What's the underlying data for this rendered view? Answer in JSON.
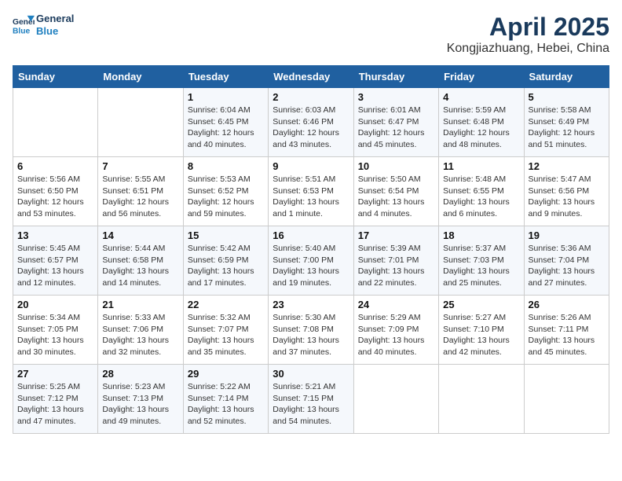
{
  "header": {
    "logo_line1": "General",
    "logo_line2": "Blue",
    "month_year": "April 2025",
    "location": "Kongjiazhuang, Hebei, China"
  },
  "weekdays": [
    "Sunday",
    "Monday",
    "Tuesday",
    "Wednesday",
    "Thursday",
    "Friday",
    "Saturday"
  ],
  "weeks": [
    [
      {
        "day": "",
        "info": ""
      },
      {
        "day": "",
        "info": ""
      },
      {
        "day": "1",
        "info": "Sunrise: 6:04 AM\nSunset: 6:45 PM\nDaylight: 12 hours and 40 minutes."
      },
      {
        "day": "2",
        "info": "Sunrise: 6:03 AM\nSunset: 6:46 PM\nDaylight: 12 hours and 43 minutes."
      },
      {
        "day": "3",
        "info": "Sunrise: 6:01 AM\nSunset: 6:47 PM\nDaylight: 12 hours and 45 minutes."
      },
      {
        "day": "4",
        "info": "Sunrise: 5:59 AM\nSunset: 6:48 PM\nDaylight: 12 hours and 48 minutes."
      },
      {
        "day": "5",
        "info": "Sunrise: 5:58 AM\nSunset: 6:49 PM\nDaylight: 12 hours and 51 minutes."
      }
    ],
    [
      {
        "day": "6",
        "info": "Sunrise: 5:56 AM\nSunset: 6:50 PM\nDaylight: 12 hours and 53 minutes."
      },
      {
        "day": "7",
        "info": "Sunrise: 5:55 AM\nSunset: 6:51 PM\nDaylight: 12 hours and 56 minutes."
      },
      {
        "day": "8",
        "info": "Sunrise: 5:53 AM\nSunset: 6:52 PM\nDaylight: 12 hours and 59 minutes."
      },
      {
        "day": "9",
        "info": "Sunrise: 5:51 AM\nSunset: 6:53 PM\nDaylight: 13 hours and 1 minute."
      },
      {
        "day": "10",
        "info": "Sunrise: 5:50 AM\nSunset: 6:54 PM\nDaylight: 13 hours and 4 minutes."
      },
      {
        "day": "11",
        "info": "Sunrise: 5:48 AM\nSunset: 6:55 PM\nDaylight: 13 hours and 6 minutes."
      },
      {
        "day": "12",
        "info": "Sunrise: 5:47 AM\nSunset: 6:56 PM\nDaylight: 13 hours and 9 minutes."
      }
    ],
    [
      {
        "day": "13",
        "info": "Sunrise: 5:45 AM\nSunset: 6:57 PM\nDaylight: 13 hours and 12 minutes."
      },
      {
        "day": "14",
        "info": "Sunrise: 5:44 AM\nSunset: 6:58 PM\nDaylight: 13 hours and 14 minutes."
      },
      {
        "day": "15",
        "info": "Sunrise: 5:42 AM\nSunset: 6:59 PM\nDaylight: 13 hours and 17 minutes."
      },
      {
        "day": "16",
        "info": "Sunrise: 5:40 AM\nSunset: 7:00 PM\nDaylight: 13 hours and 19 minutes."
      },
      {
        "day": "17",
        "info": "Sunrise: 5:39 AM\nSunset: 7:01 PM\nDaylight: 13 hours and 22 minutes."
      },
      {
        "day": "18",
        "info": "Sunrise: 5:37 AM\nSunset: 7:03 PM\nDaylight: 13 hours and 25 minutes."
      },
      {
        "day": "19",
        "info": "Sunrise: 5:36 AM\nSunset: 7:04 PM\nDaylight: 13 hours and 27 minutes."
      }
    ],
    [
      {
        "day": "20",
        "info": "Sunrise: 5:34 AM\nSunset: 7:05 PM\nDaylight: 13 hours and 30 minutes."
      },
      {
        "day": "21",
        "info": "Sunrise: 5:33 AM\nSunset: 7:06 PM\nDaylight: 13 hours and 32 minutes."
      },
      {
        "day": "22",
        "info": "Sunrise: 5:32 AM\nSunset: 7:07 PM\nDaylight: 13 hours and 35 minutes."
      },
      {
        "day": "23",
        "info": "Sunrise: 5:30 AM\nSunset: 7:08 PM\nDaylight: 13 hours and 37 minutes."
      },
      {
        "day": "24",
        "info": "Sunrise: 5:29 AM\nSunset: 7:09 PM\nDaylight: 13 hours and 40 minutes."
      },
      {
        "day": "25",
        "info": "Sunrise: 5:27 AM\nSunset: 7:10 PM\nDaylight: 13 hours and 42 minutes."
      },
      {
        "day": "26",
        "info": "Sunrise: 5:26 AM\nSunset: 7:11 PM\nDaylight: 13 hours and 45 minutes."
      }
    ],
    [
      {
        "day": "27",
        "info": "Sunrise: 5:25 AM\nSunset: 7:12 PM\nDaylight: 13 hours and 47 minutes."
      },
      {
        "day": "28",
        "info": "Sunrise: 5:23 AM\nSunset: 7:13 PM\nDaylight: 13 hours and 49 minutes."
      },
      {
        "day": "29",
        "info": "Sunrise: 5:22 AM\nSunset: 7:14 PM\nDaylight: 13 hours and 52 minutes."
      },
      {
        "day": "30",
        "info": "Sunrise: 5:21 AM\nSunset: 7:15 PM\nDaylight: 13 hours and 54 minutes."
      },
      {
        "day": "",
        "info": ""
      },
      {
        "day": "",
        "info": ""
      },
      {
        "day": "",
        "info": ""
      }
    ]
  ]
}
